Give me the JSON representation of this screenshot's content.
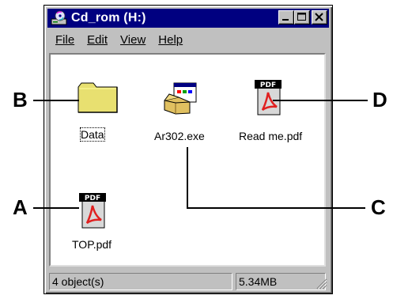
{
  "window": {
    "title": "Cd_rom (H:)",
    "icon": "cd-drive-icon"
  },
  "menu": {
    "file": "File",
    "edit": "Edit",
    "view": "View",
    "help": "Help"
  },
  "files": [
    {
      "label": "Data",
      "icon": "folder-icon",
      "focused": true
    },
    {
      "label": "Ar302.exe",
      "icon": "installer-icon"
    },
    {
      "label": "Read me.pdf",
      "icon": "pdf-icon"
    },
    {
      "label": "TOP.pdf",
      "icon": "pdf-icon"
    }
  ],
  "status": {
    "count": "4 object(s)",
    "size": "5.34MB"
  },
  "callouts": {
    "a": "A",
    "b": "B",
    "c": "C",
    "d": "D"
  },
  "pdf_badge": "PDF",
  "colors": {
    "titlebar": "#000080",
    "chrome": "#c0c0c0",
    "folder": "#e8e070",
    "pdf_red": "#e02020"
  }
}
